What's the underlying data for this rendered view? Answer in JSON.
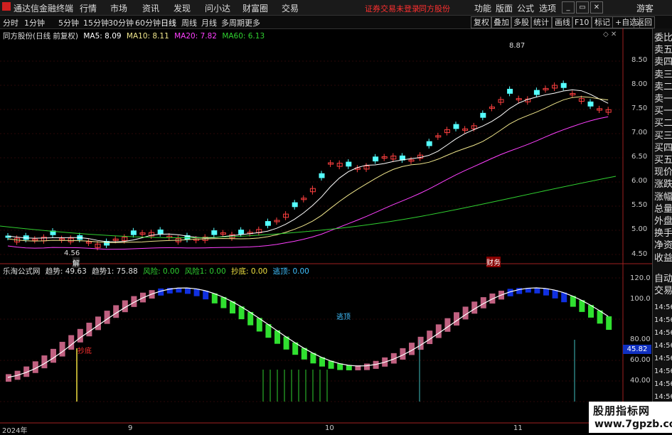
{
  "app": {
    "title": "通达信金融终端",
    "menu": [
      "行情",
      "市场",
      "资讯",
      "发现",
      "问小达",
      "财富圈",
      "交易"
    ],
    "warning": "证券交易未登录",
    "stock_name": "同方股份",
    "right_menu": [
      "功能",
      "版面",
      "公式",
      "选项"
    ],
    "guest": "游客"
  },
  "toolbar": {
    "periods": [
      "分时",
      "1分钟",
      "5分钟",
      "15分钟",
      "30分钟",
      "60分钟",
      "日线",
      "周线",
      "月线",
      "多周期",
      "更多"
    ],
    "active": "日线",
    "right_buttons": [
      "复权",
      "叠加",
      "多股",
      "统计",
      "画线",
      "F10",
      "标记",
      "+自选",
      "返回"
    ]
  },
  "main_chart": {
    "caption": "同方股份(日线 前复权)",
    "ma": [
      {
        "label": "MA5: 8.09",
        "color": "#ffffff"
      },
      {
        "label": "MA10: 8.11",
        "color": "#f0e68c"
      },
      {
        "label": "MA20: 7.82",
        "color": "#ff40ff"
      },
      {
        "label": "MA60: 6.13",
        "color": "#30d030"
      }
    ],
    "high_label": "8.87",
    "low_label": "4.56",
    "mark_jie": "解",
    "mark_caibiao": "财务",
    "y_ticks": [
      "8.50",
      "8.00",
      "7.50",
      "7.00",
      "6.50",
      "6.00",
      "5.50",
      "5.00",
      "4.50"
    ]
  },
  "indicator": {
    "caption": "乐淘公式网",
    "values": [
      {
        "label": "趋势: 49.63",
        "color": "#e0e0e0"
      },
      {
        "label": "趋势1: 75.88",
        "color": "#e0e0e0"
      },
      {
        "label": "风险: 0.00",
        "color": "#30d030"
      },
      {
        "label": "风险1: 0.00",
        "color": "#30d030"
      },
      {
        "label": "抄底: 0.00",
        "color": "#f0e040"
      },
      {
        "label": "逃顶: 0.00",
        "color": "#40c0ff"
      }
    ],
    "mark_chaodi": "抄底",
    "mark_taoding": "逃顶",
    "y_ticks": [
      "120.0",
      "100.0",
      "80.00",
      "60.00",
      "40.00",
      "20.00"
    ],
    "current_value": "45.82"
  },
  "right_panel": [
    "委比",
    "卖五",
    "卖四",
    "卖三",
    "卖二",
    "卖一",
    "买一",
    "买二",
    "买三",
    "买四",
    "买五",
    "现价",
    "涨跌",
    "涨幅",
    "总量",
    "外盘",
    "换手",
    "净资",
    "收益",
    "自动",
    "交易",
    "14:56",
    "14:56",
    "14:56",
    "14:56",
    "14:56",
    "14:56",
    "14:56",
    "14:56",
    "14:56",
    "14:56"
  ],
  "x_dates": [
    "2024年",
    "9",
    "10",
    "11"
  ],
  "watermark": {
    "line1": "股朋指标网",
    "line2": "www.7gpzb.com"
  }
}
